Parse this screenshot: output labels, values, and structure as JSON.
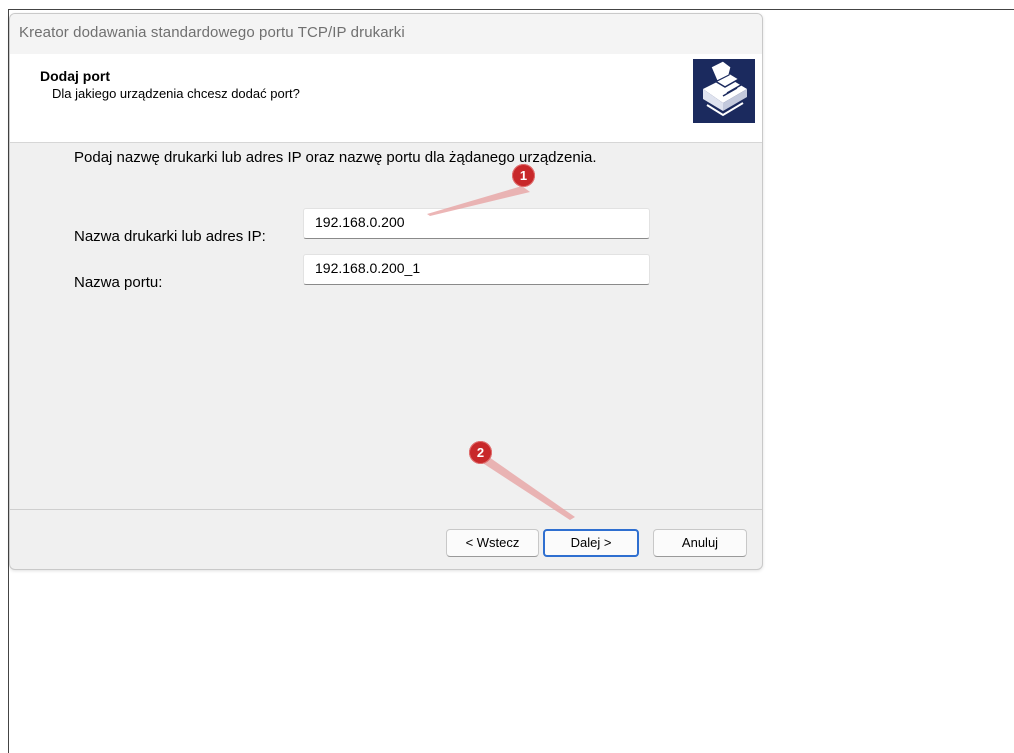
{
  "window": {
    "title": "Kreator dodawania standardowego portu TCP/IP drukarki"
  },
  "header": {
    "title": "Dodaj port",
    "subtitle": "Dla jakiego urządzenia chcesz dodać port?",
    "icon": "printer-wizard-icon",
    "icon_bg_color": "#1b2a5e"
  },
  "body": {
    "instruction": "Podaj nazwę drukarki lub adres IP oraz nazwę portu dla żądanego urządzenia.",
    "fields": [
      {
        "label": "Nazwa drukarki lub adres IP:",
        "value": "192.168.0.200"
      },
      {
        "label": "Nazwa portu:",
        "value": "192.168.0.200_1"
      }
    ]
  },
  "buttons": {
    "back": "< Wstecz",
    "next": "Dalej >",
    "cancel": "Anuluj"
  },
  "annotations": {
    "badge_1": "1",
    "badge_2": "2",
    "badge_color": "#c8282a"
  }
}
